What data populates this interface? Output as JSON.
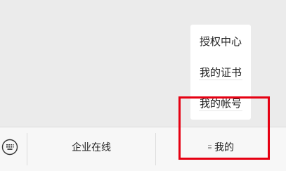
{
  "popup_menu": {
    "items": [
      {
        "label": "授权中心"
      },
      {
        "label": "我的证书"
      },
      {
        "label": "我的帐号"
      }
    ]
  },
  "bottom_bar": {
    "keyboard_icon": "keyboard-icon",
    "tabs": [
      {
        "label": "企业在线",
        "has_menu_glyph": false
      },
      {
        "label": "我的",
        "has_menu_glyph": true
      }
    ]
  },
  "annotation": {
    "highlight_color": "#e60012"
  }
}
